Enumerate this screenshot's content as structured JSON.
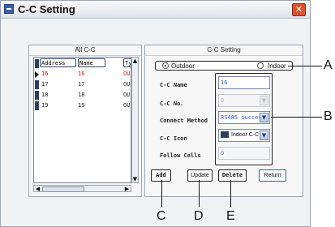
{
  "window": {
    "title": "C-C Setting",
    "close": "✕"
  },
  "left_panel": {
    "title": "All C-C",
    "columns": [
      "Address",
      "Name",
      "Ty"
    ],
    "rows": [
      {
        "address": "16",
        "name": "16",
        "type": "OU",
        "current": true
      },
      {
        "address": "17",
        "name": "17",
        "type": "OU",
        "current": false
      },
      {
        "address": "18",
        "name": "18",
        "type": "OU",
        "current": false
      },
      {
        "address": "19",
        "name": "19",
        "type": "OU",
        "current": false
      }
    ]
  },
  "right_panel": {
    "title": "C-C Setting",
    "radio": {
      "outdoor": "Outdoor",
      "indoor": "Indoor",
      "selected": "Outdoor"
    },
    "fields": {
      "name": {
        "label": "C-C Name",
        "value": "16"
      },
      "no": {
        "label": "C-C No.",
        "value": "0"
      },
      "method": {
        "label": "Connect Method",
        "value": "RS485 succes:"
      },
      "icon": {
        "label": "C-C Icon",
        "value": "Indoor C-C"
      },
      "follow": {
        "label": "Follow Cells",
        "value": "0"
      }
    },
    "buttons": {
      "add": "Add",
      "update": "Update",
      "delete": "Delete",
      "return": "Return"
    }
  },
  "callouts": {
    "a": "A",
    "b": "B",
    "c": "C",
    "d": "D",
    "e": "E"
  }
}
